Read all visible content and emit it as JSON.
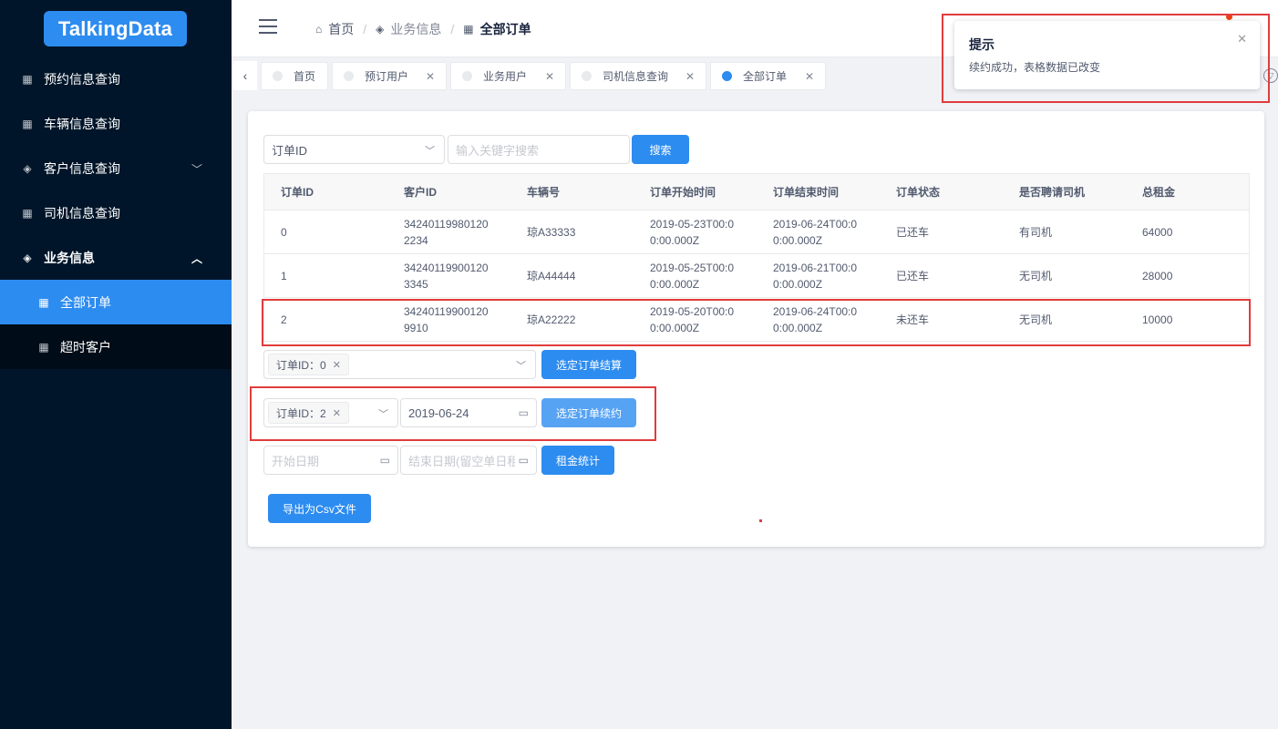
{
  "brand": {
    "logo_text": "TalkingData"
  },
  "sidebar": {
    "items": [
      {
        "label": "预约信息查询",
        "icon": "grid-icon"
      },
      {
        "label": "车辆信息查询",
        "icon": "grid-icon"
      },
      {
        "label": "客户信息查询",
        "icon": "layers-icon",
        "expanded": false
      },
      {
        "label": "司机信息查询",
        "icon": "grid-icon"
      },
      {
        "label": "业务信息",
        "icon": "layers-icon",
        "expanded": true
      }
    ],
    "submenu": [
      {
        "label": "全部订单",
        "active": true
      },
      {
        "label": "超时客户",
        "active": false
      }
    ]
  },
  "header": {
    "breadcrumb": [
      "首页",
      "业务信息",
      "全部订单"
    ]
  },
  "tabs": [
    {
      "label": "首页",
      "active": false
    },
    {
      "label": "预订用户",
      "active": false
    },
    {
      "label": "业务用户",
      "active": false
    },
    {
      "label": "司机信息查询",
      "active": false
    },
    {
      "label": "全部订单",
      "active": true
    }
  ],
  "search": {
    "field_select": "订单ID",
    "keyword_placeholder": "输入关键字搜索",
    "search_label": "搜索"
  },
  "table": {
    "columns": [
      "订单ID",
      "客户ID",
      "车辆号",
      "订单开始时间",
      "订单结束时间",
      "订单状态",
      "是否聘请司机",
      "总租金"
    ],
    "rows": [
      {
        "id": "0",
        "customer": [
          "34240119980120",
          "2234"
        ],
        "car": "琼A33333",
        "start": [
          "2019-05-23T00:0",
          "0:00.000Z"
        ],
        "end": [
          "2019-06-24T00:0",
          "0:00.000Z"
        ],
        "status": "已还车",
        "driver": "有司机",
        "rent": "64000"
      },
      {
        "id": "1",
        "customer": [
          "34240119900120",
          "3345"
        ],
        "car": "琼A44444",
        "start": [
          "2019-05-25T00:0",
          "0:00.000Z"
        ],
        "end": [
          "2019-06-21T00:0",
          "0:00.000Z"
        ],
        "status": "已还车",
        "driver": "无司机",
        "rent": "28000"
      },
      {
        "id": "2",
        "customer": [
          "34240119900120",
          "9910"
        ],
        "car": "琼A22222",
        "start": [
          "2019-05-20T00:0",
          "0:00.000Z"
        ],
        "end": [
          "2019-06-24T00:0",
          "0:00.000Z"
        ],
        "status": "未还车",
        "driver": "无司机",
        "rent": "10000"
      }
    ]
  },
  "settle": {
    "tag": "订单ID：0",
    "button": "选定订单结算"
  },
  "renew": {
    "tag": "订单ID：2",
    "date": "2019-06-24",
    "button": "选定订单续约"
  },
  "stats": {
    "start_placeholder": "开始日期",
    "end_placeholder": "结束日期(留空单日租",
    "button": "租金统计"
  },
  "export": {
    "button": "导出为Csv文件"
  },
  "notice": {
    "title": "提示",
    "desc": "续约成功，表格数据已改变"
  },
  "colors": {
    "sidebar_bg": "#001529",
    "primary": "#2d8cf0",
    "annotation_red": "#e03c3c"
  }
}
